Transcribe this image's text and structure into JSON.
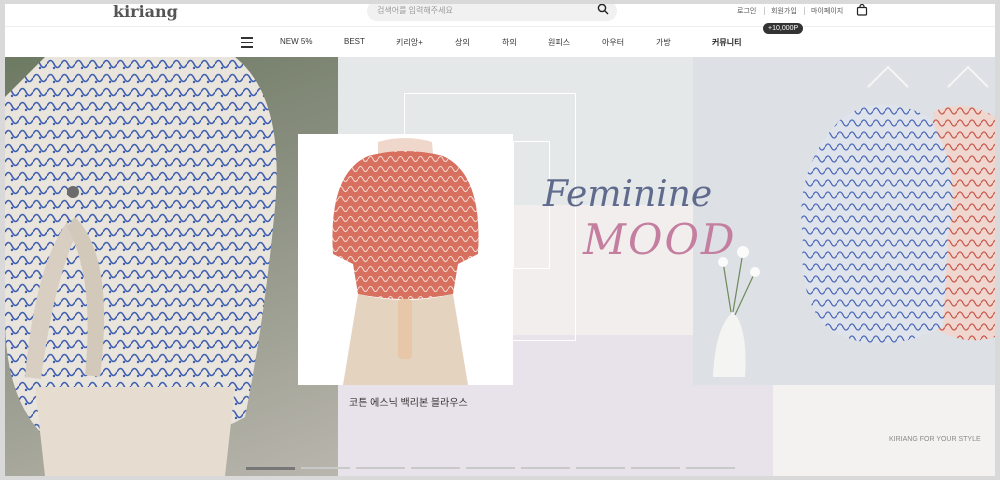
{
  "header": {
    "logo": "kiriang",
    "search_placeholder": "검색어를 입력해주세요",
    "util_links": [
      "로그인",
      "회원가입",
      "마이페이지"
    ],
    "reward_badge": "+10,000P"
  },
  "nav": {
    "items": [
      "NEW 5%",
      "BEST",
      "키리앙+",
      "상의",
      "하의",
      "원피스",
      "아우터",
      "가방",
      "커뮤니티"
    ]
  },
  "banner": {
    "headline_1": "Feminine",
    "headline_2": "MOOD",
    "product_caption": "코튼 에스닉 백리본 블라우스",
    "tagline": "KIRIANG FOR YOUR STYLE",
    "slide_count": 9,
    "active_slide": 1
  },
  "colors": {
    "headline_1": "#606a8c",
    "headline_2": "#c47ea0",
    "blouse_blue": "#3f5fb0",
    "blouse_red": "#c9584b"
  }
}
